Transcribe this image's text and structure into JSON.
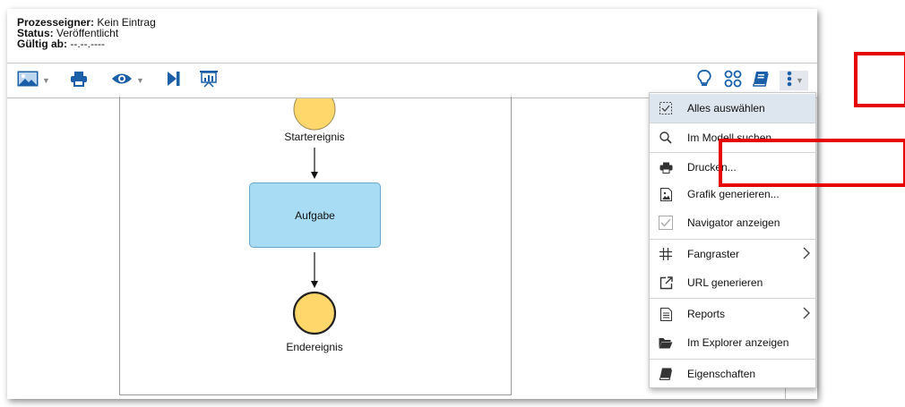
{
  "header": {
    "owner_label": "Prozesseigner:",
    "owner_value": "Kein Eintrag",
    "status_label": "Status:",
    "status_value": "Veröffentlicht",
    "valid_label": "Gültig ab:",
    "valid_value": "--.--.----"
  },
  "toolbar": {
    "left_icons": [
      "image-icon",
      "print-icon",
      "view-icon",
      "step-forward-icon",
      "presentation-icon"
    ],
    "right_icons": [
      "lightbulb-icon",
      "modules-icon",
      "properties-book-icon",
      "more-vertical-icon"
    ]
  },
  "diagram": {
    "start_event_label": "Startereignis",
    "task_label": "Aufgabe",
    "end_event_label": "Endereignis",
    "event_color": "#ffd76a",
    "task_color": "#a8dcf5"
  },
  "menu": {
    "items": [
      {
        "label": "Alles auswählen",
        "icon": "select-all-icon",
        "highlighted": true
      },
      {
        "label": "Im Modell suchen",
        "icon": "search-icon"
      },
      {
        "label": "Drucken...",
        "icon": "print-icon"
      },
      {
        "label": "Grafik generieren...",
        "icon": "image-generate-icon"
      },
      {
        "label": "Navigator anzeigen",
        "icon": "checkbox-icon"
      },
      {
        "label": "Fangraster",
        "icon": "grid-icon",
        "submenu": true
      },
      {
        "label": "URL generieren",
        "icon": "external-link-icon"
      },
      {
        "label": "Reports",
        "icon": "document-icon",
        "submenu": true
      },
      {
        "label": "Im Explorer anzeigen",
        "icon": "folder-icon"
      },
      {
        "label": "Eigenschaften",
        "icon": "book-icon"
      }
    ]
  },
  "colors": {
    "accent_blue": "#1a5fa8",
    "highlight_red": "#e60000"
  }
}
